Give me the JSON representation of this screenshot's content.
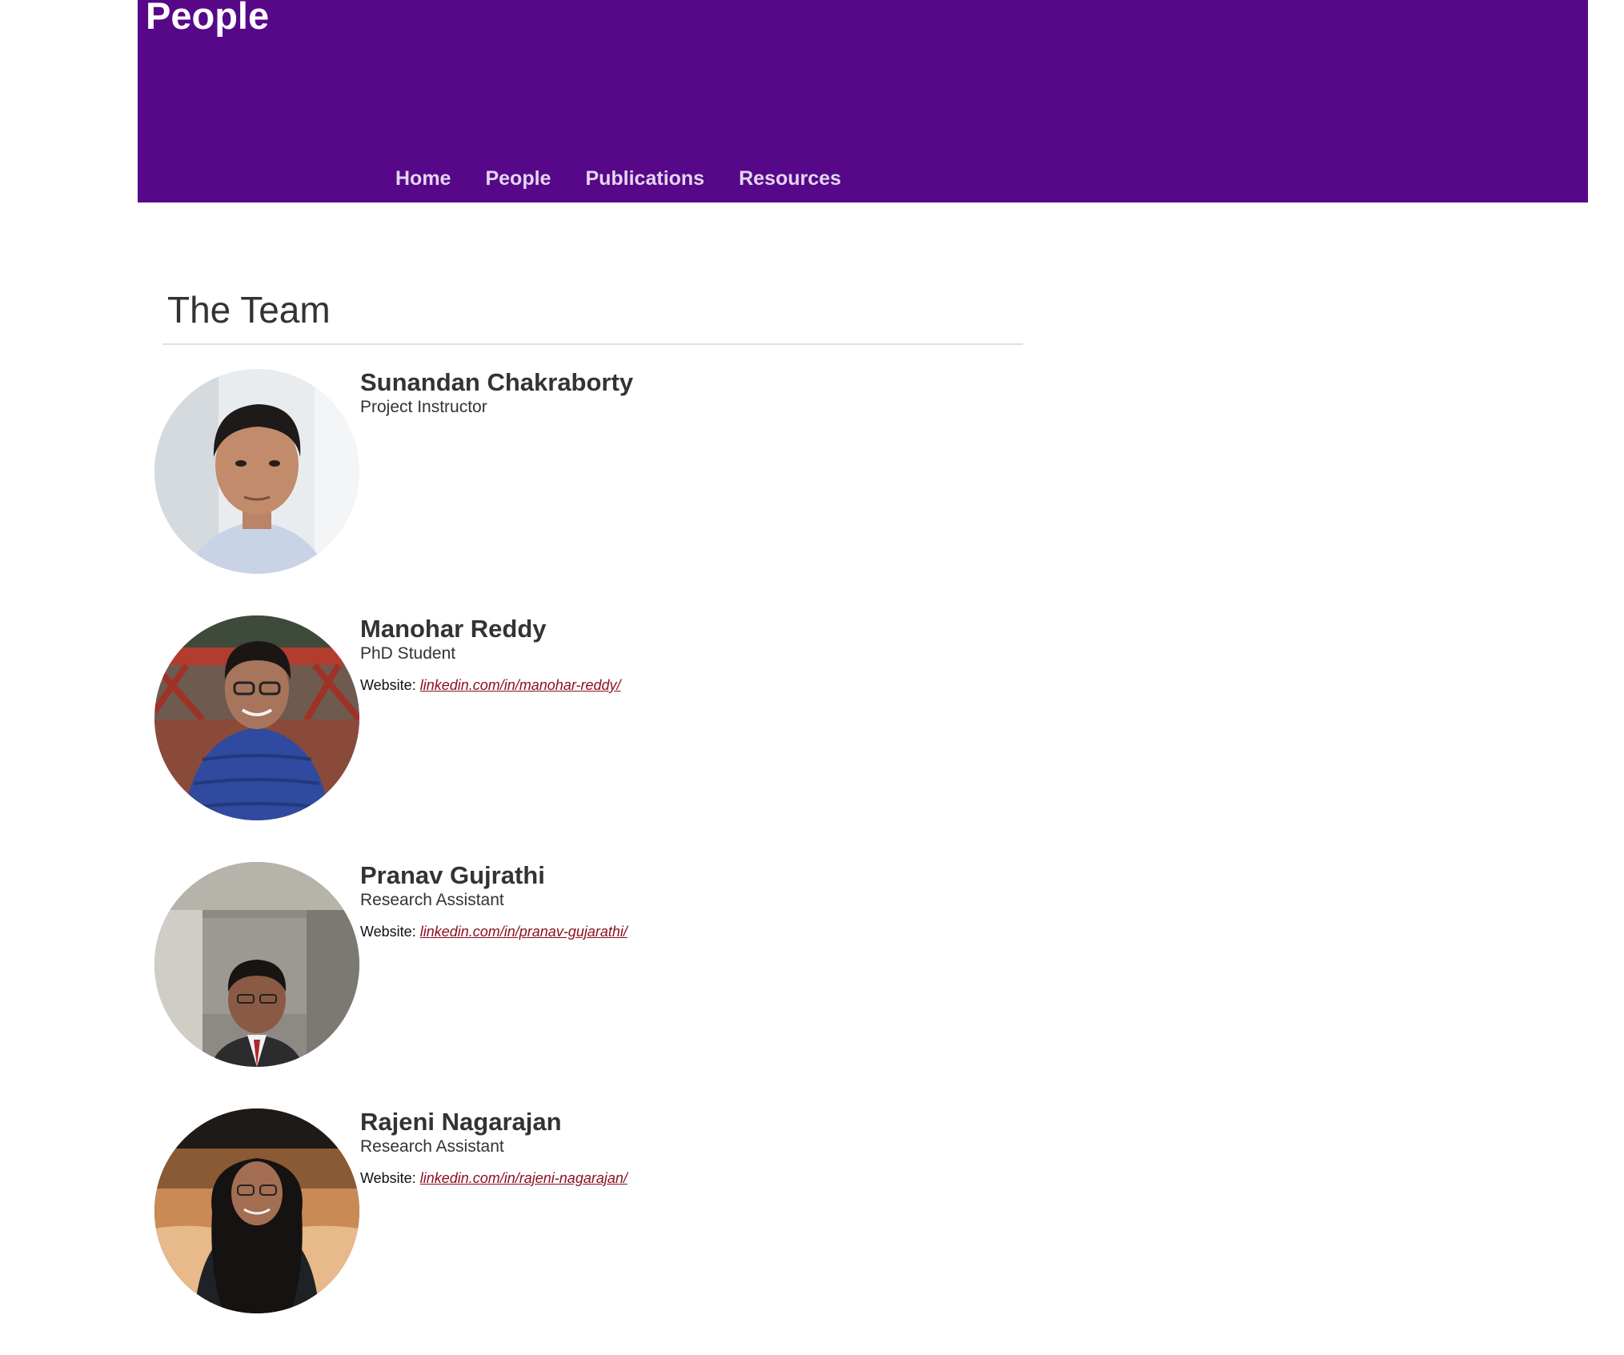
{
  "header": {
    "title": "People",
    "nav": [
      {
        "label": "Home"
      },
      {
        "label": "People"
      },
      {
        "label": "Publications"
      },
      {
        "label": "Resources"
      }
    ],
    "background_color": "#570889"
  },
  "team": {
    "title": "The Team",
    "website_prefix": "Website:",
    "members": [
      {
        "name": "Sunandan Chakraborty",
        "role": "Project Instructor",
        "website": ""
      },
      {
        "name": "Manohar Reddy",
        "role": "PhD Student",
        "website": "linkedin.com/in/manohar-reddy/"
      },
      {
        "name": "Pranav Gujrathi",
        "role": "Research Assistant",
        "website": "linkedin.com/in/pranav-gujarathi/"
      },
      {
        "name": "Rajeni Nagarajan",
        "role": "Research Assistant",
        "website": "linkedin.com/in/rajeni-nagarajan/"
      }
    ]
  },
  "colors": {
    "link": "#8b0e1e",
    "nav_text": "#e3d6ee",
    "text": "#333333"
  }
}
